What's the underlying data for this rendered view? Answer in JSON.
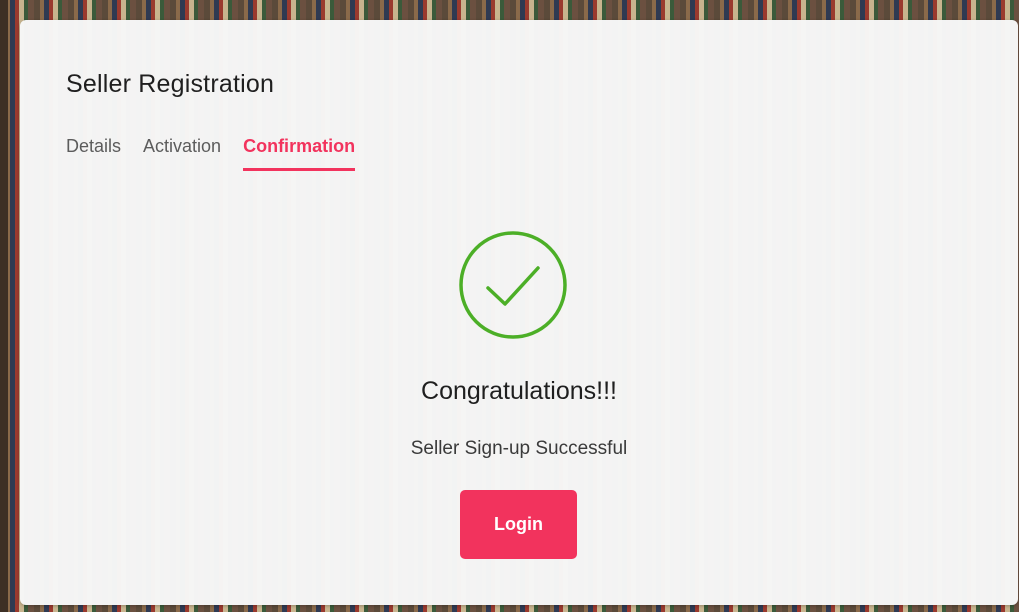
{
  "modal": {
    "title": "Seller Registration"
  },
  "tabs": [
    {
      "label": "Details",
      "active": false
    },
    {
      "label": "Activation",
      "active": false
    },
    {
      "label": "Confirmation",
      "active": true
    }
  ],
  "confirmation": {
    "icon": "check-circle-icon",
    "heading": "Congratulations!!!",
    "message": "Seller Sign-up Successful",
    "login_label": "Login"
  },
  "colors": {
    "accent": "#f2335d",
    "success": "#4caf27"
  }
}
